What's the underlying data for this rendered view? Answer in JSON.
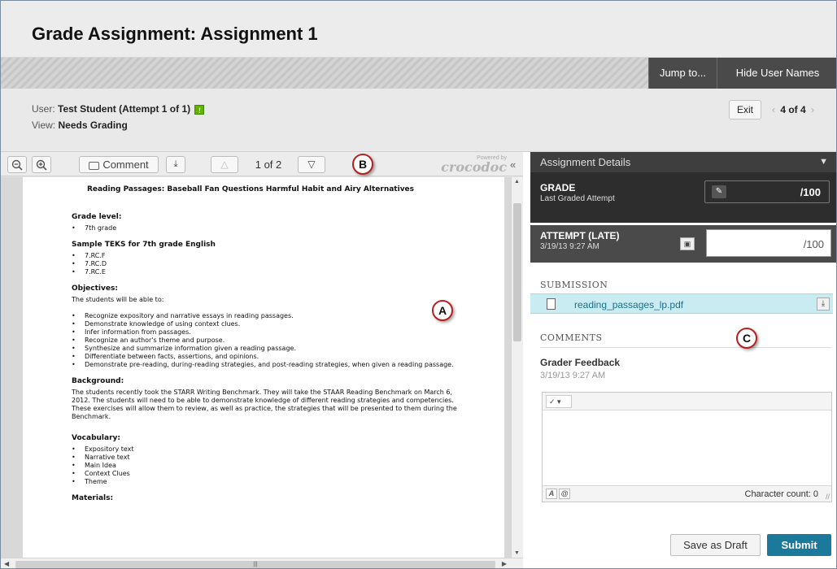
{
  "header": {
    "title": "Grade Assignment: Assignment 1"
  },
  "action_bar": {
    "jump_label": "Jump to...",
    "hide_names_label": "Hide User Names"
  },
  "user_info": {
    "user_label": "User:",
    "user_value": "Test Student (Attempt 1 of 1)",
    "view_label": "View:",
    "view_value": "Needs Grading",
    "exit_label": "Exit",
    "pager": "4 of 4"
  },
  "viewer": {
    "comment_label": "Comment",
    "page_indicator": "1 of 2",
    "powered_by": "Powered by",
    "brand": "crocodoc",
    "document": {
      "title": "Reading Passages:  Baseball Fan Questions Harmful Habit and Airy Alternatives",
      "grade_heading": "Grade level:",
      "grade_item": "7th grade",
      "teks_heading": "Sample TEKS for 7th grade English",
      "teks_items": [
        "7.RC.F",
        "7.RC.D",
        "7.RC.E"
      ],
      "objectives_heading": "Objectives:",
      "objectives_intro": "The students will be able to:",
      "objectives": [
        "Recognize expository and narrative essays in reading passages.",
        "Demonstrate knowledge of using context clues.",
        "Infer information from passages.",
        "Recognize an author's theme and purpose.",
        "Synthesize and summarize information given a reading passage.",
        "Differentiate between facts, assertions, and opinions.",
        "Demonstrate pre-reading, during-reading strategies, and post-reading strategies, when given a reading passage."
      ],
      "background_heading": "Background:",
      "background_text": "The students recently took the STARR Writing Benchmark.  They will take the STAAR Reading Benchmark on March 6, 2012.  The students will need to be able to demonstrate knowledge of different reading strategies and competencies.  These exercises will allow them to review, as well as practice, the strategies that will be presented to them during the Benchmark.",
      "vocabulary_heading": "Vocabulary:",
      "vocabulary": [
        "Expository text",
        "Narrative text",
        "Main Idea",
        "Context Clues",
        "Theme"
      ],
      "materials_heading": "Materials:"
    }
  },
  "panel": {
    "details_label": "Assignment Details",
    "grade_label": "GRADE",
    "grade_sub": "Last Graded Attempt",
    "grade_value": "/100",
    "attempt_label": "ATTEMPT (LATE)",
    "attempt_date": "3/19/13 9:27 AM",
    "attempt_value": "/100",
    "submission_label": "SUBMISSION",
    "file_name": "reading_passages_lp.pdf",
    "comments_label": "COMMENTS",
    "feedback_label": "Grader Feedback",
    "feedback_date": "3/19/13 9:27 AM",
    "char_count": "Character count: 0",
    "save_draft_label": "Save as Draft",
    "submit_label": "Submit"
  },
  "callouts": {
    "a": "A",
    "b": "B",
    "c": "C"
  },
  "colors": {
    "submit": "#1b7a9c",
    "file_highlight": "#c9ecf3",
    "callout_ring": "#b22222",
    "status_check": "#5fb300"
  }
}
